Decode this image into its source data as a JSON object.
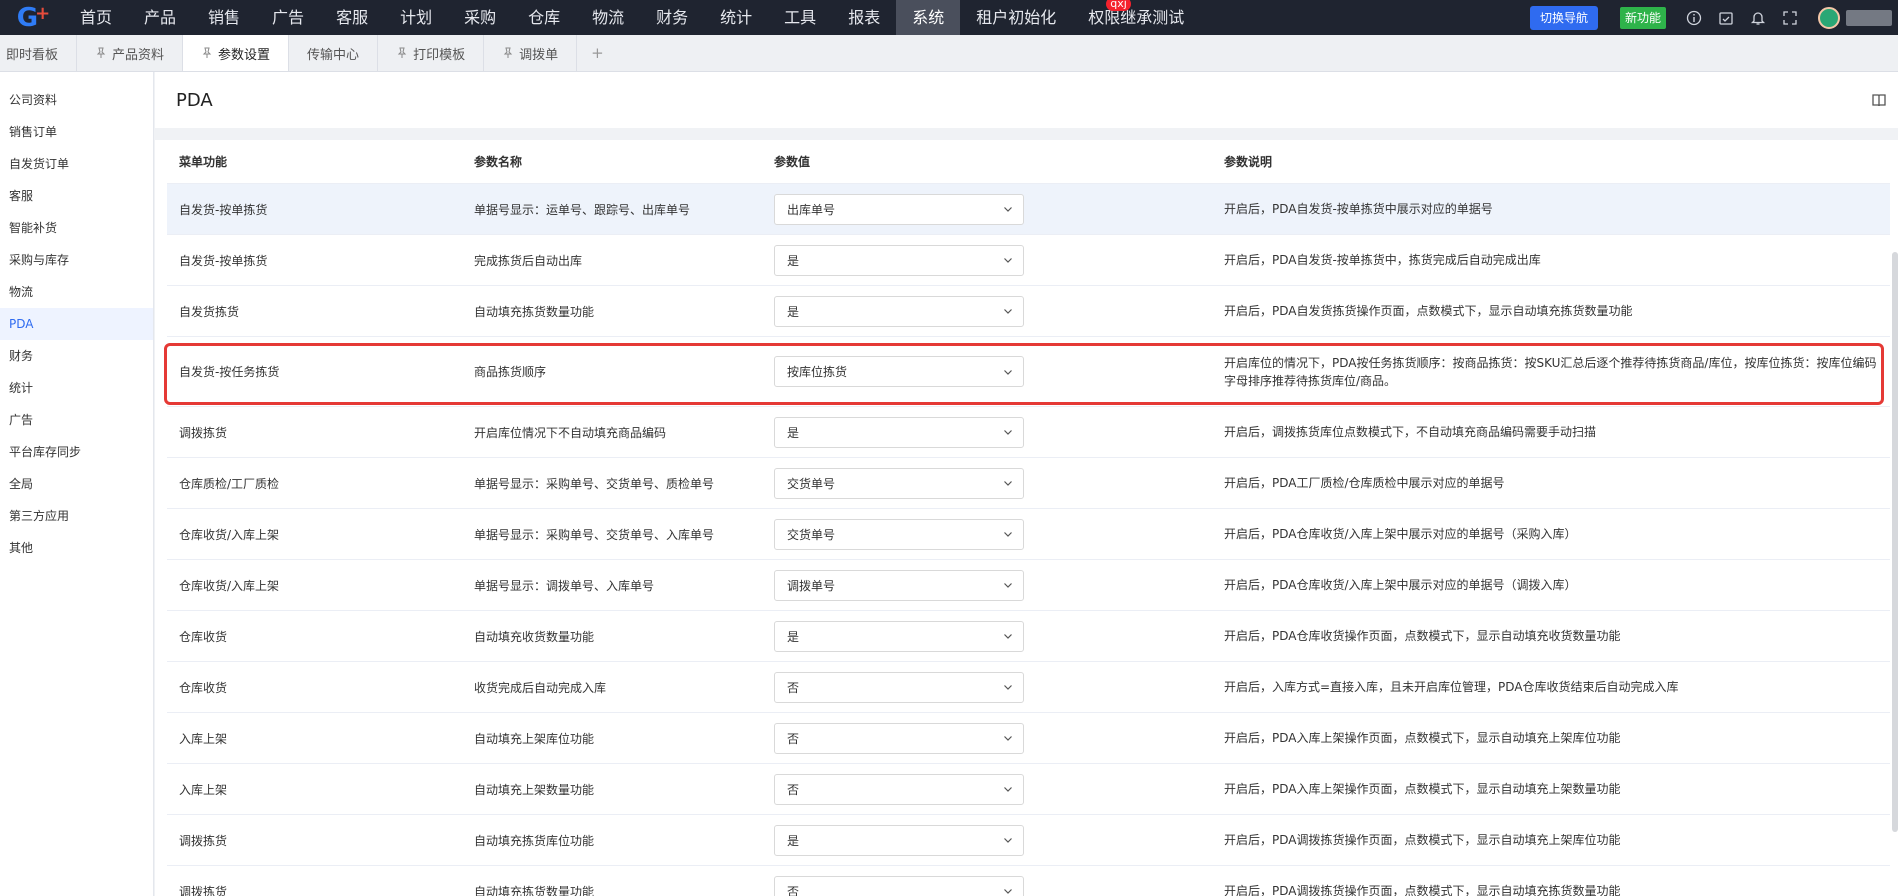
{
  "topnav": {
    "logo_text": "G",
    "items": [
      "首页",
      "产品",
      "销售",
      "广告",
      "客服",
      "计划",
      "采购",
      "仓库",
      "物流",
      "财务",
      "统计",
      "工具",
      "报表",
      "系统",
      "租户初始化",
      "权限继承测试"
    ],
    "active_index": 13,
    "badge": "qxj",
    "switch_nav_label": "切换导航",
    "new_feature_label": "新功能",
    "icons": [
      "info-icon",
      "check-calendar-icon",
      "bell-icon",
      "fullscreen-icon"
    ]
  },
  "tabs": {
    "items": [
      "即时看板",
      "产品资料",
      "参数设置",
      "传输中心",
      "打印模板",
      "调拨单"
    ],
    "active_index": 2,
    "add_label": "+"
  },
  "sidebar": {
    "items": [
      "公司资料",
      "销售订单",
      "自发货订单",
      "客服",
      "智能补货",
      "采购与库存",
      "物流",
      "PDA",
      "财务",
      "统计",
      "广告",
      "平台库存同步",
      "全局",
      "第三方应用",
      "其他"
    ],
    "active_index": 7
  },
  "page": {
    "title": "PDA"
  },
  "table": {
    "headers": [
      "菜单功能",
      "参数名称",
      "参数值",
      "参数说明"
    ],
    "rows": [
      {
        "menu": "自发货-按单拣货",
        "name": "单据号显示：运单号、跟踪号、出库单号",
        "value": "出库单号",
        "desc": "开启后，PDA自发货-按单拣货中展示对应的单据号"
      },
      {
        "menu": "自发货-按单拣货",
        "name": "完成拣货后自动出库",
        "value": "是",
        "desc": "开启后，PDA自发货-按单拣货中，拣货完成后自动完成出库"
      },
      {
        "menu": "自发货拣货",
        "name": "自动填充拣货数量功能",
        "value": "是",
        "desc": "开启后，PDA自发货拣货操作页面，点数模式下，显示自动填充拣货数量功能"
      },
      {
        "menu": "自发货-按任务拣货",
        "name": "商品拣货顺序",
        "value": "按库位拣货",
        "desc": "开启库位的情况下，PDA按任务拣货顺序：按商品拣货：按SKU汇总后逐个推荐待拣货商品/库位，按库位拣货：按库位编码字母排序推荐待拣货库位/商品。"
      },
      {
        "menu": "调拨拣货",
        "name": "开启库位情况下不自动填充商品编码",
        "value": "是",
        "desc": "开启后，调拨拣货库位点数模式下，不自动填充商品编码需要手动扫描"
      },
      {
        "menu": "仓库质检/工厂质检",
        "name": "单据号显示：采购单号、交货单号、质检单号",
        "value": "交货单号",
        "desc": "开启后，PDA工厂质检/仓库质检中展示对应的单据号"
      },
      {
        "menu": "仓库收货/入库上架",
        "name": "单据号显示：采购单号、交货单号、入库单号",
        "value": "交货单号",
        "desc": "开启后，PDA仓库收货/入库上架中展示对应的单据号（采购入库）"
      },
      {
        "menu": "仓库收货/入库上架",
        "name": "单据号显示：调拨单号、入库单号",
        "value": "调拨单号",
        "desc": "开启后，PDA仓库收货/入库上架中展示对应的单据号（调拨入库）"
      },
      {
        "menu": "仓库收货",
        "name": "自动填充收货数量功能",
        "value": "是",
        "desc": "开启后，PDA仓库收货操作页面，点数模式下，显示自动填充收货数量功能"
      },
      {
        "menu": "仓库收货",
        "name": "收货完成后自动完成入库",
        "value": "否",
        "desc": "开启后，入库方式=直接入库，且未开启库位管理，PDA仓库收货结束后自动完成入库"
      },
      {
        "menu": "入库上架",
        "name": "自动填充上架库位功能",
        "value": "否",
        "desc": "开启后，PDA入库上架操作页面，点数模式下，显示自动填充上架库位功能"
      },
      {
        "menu": "入库上架",
        "name": "自动填充上架数量功能",
        "value": "否",
        "desc": "开启后，PDA入库上架操作页面，点数模式下，显示自动填充上架数量功能"
      },
      {
        "menu": "调拨拣货",
        "name": "自动填充拣货库位功能",
        "value": "是",
        "desc": "开启后，PDA调拨拣货操作页面，点数模式下，显示自动填充上架库位功能"
      },
      {
        "menu": "调拨拣货",
        "name": "自动填充拣货数量功能",
        "value": "否",
        "desc": "开启后，PDA调拨拣货操作页面，点数模式下，显示自动填充拣货数量功能"
      }
    ],
    "highlight_row": 0,
    "tall_row": 3
  },
  "colors": {
    "topnav_bg": "#1f2430",
    "accent": "#2f6bf0",
    "new_feature": "#2eb34a",
    "callout": "#e53935"
  }
}
